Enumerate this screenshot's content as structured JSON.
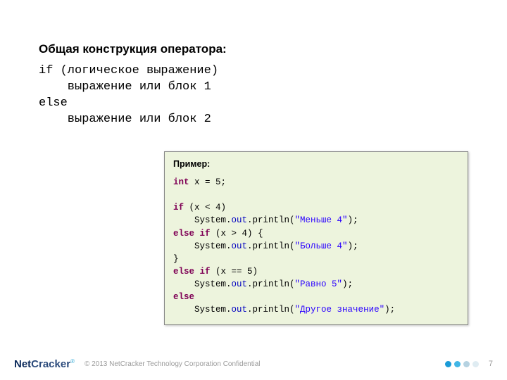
{
  "heading": "Общая конструкция оператора:",
  "syntax": "if (логическое выражение)\n    выражение или блок 1\nelse\n    выражение или блок 2",
  "example": {
    "title": "Пример:",
    "code_tokens": [
      {
        "t": "int",
        "c": "kw"
      },
      {
        "t": " x "
      },
      {
        "t": "=",
        "c": ""
      },
      {
        "t": " 5;"
      },
      {
        "t": "\n\n"
      },
      {
        "t": "if",
        "c": "kw"
      },
      {
        "t": " (x < 4)"
      },
      {
        "t": "\n    System."
      },
      {
        "t": "out",
        "c": "field"
      },
      {
        "t": ".println("
      },
      {
        "t": "\"Меньше 4\"",
        "c": "str"
      },
      {
        "t": ");"
      },
      {
        "t": "\n"
      },
      {
        "t": "else if",
        "c": "kw"
      },
      {
        "t": " (x > 4) {"
      },
      {
        "t": "\n    System."
      },
      {
        "t": "out",
        "c": "field"
      },
      {
        "t": ".println("
      },
      {
        "t": "\"Больше 4\"",
        "c": "str"
      },
      {
        "t": ");"
      },
      {
        "t": "\n"
      },
      {
        "t": "}",
        "c": "brace"
      },
      {
        "t": "\n"
      },
      {
        "t": "else if",
        "c": "kw"
      },
      {
        "t": " (x == 5)"
      },
      {
        "t": "\n    System."
      },
      {
        "t": "out",
        "c": "field"
      },
      {
        "t": ".println("
      },
      {
        "t": "\"Равно 5\"",
        "c": "str"
      },
      {
        "t": ");"
      },
      {
        "t": "\n"
      },
      {
        "t": "else",
        "c": "kw"
      },
      {
        "t": "\n    System."
      },
      {
        "t": "out",
        "c": "field"
      },
      {
        "t": ".println("
      },
      {
        "t": "\"Другое значение\"",
        "c": "str"
      },
      {
        "t": ");"
      }
    ]
  },
  "footer": {
    "logo_net": "Net",
    "logo_cracker": "Cracker",
    "reg": "®",
    "confidential": "© 2013 NetCracker Technology Corporation Confidential",
    "page": "7"
  }
}
